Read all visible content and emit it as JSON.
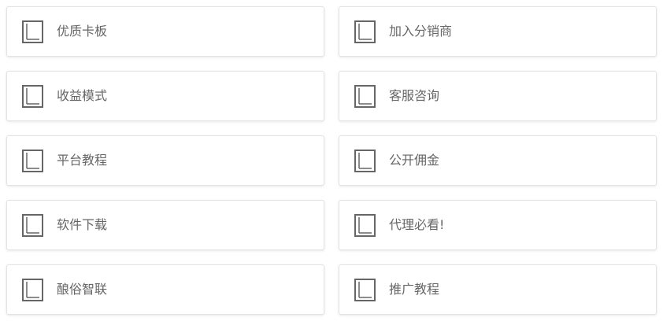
{
  "menu": {
    "items": [
      {
        "label": "优质卡板",
        "icon": "book-icon"
      },
      {
        "label": "加入分销商",
        "icon": "book-icon"
      },
      {
        "label": "收益模式",
        "icon": "book-icon"
      },
      {
        "label": "客服咨询",
        "icon": "book-icon"
      },
      {
        "label": "平台教程",
        "icon": "book-icon"
      },
      {
        "label": "公开佣金",
        "icon": "book-icon"
      },
      {
        "label": "软件下载",
        "icon": "book-icon"
      },
      {
        "label": "代理必看!",
        "icon": "book-icon"
      },
      {
        "label": "酿俗智联",
        "icon": "book-icon"
      },
      {
        "label": "推广教程",
        "icon": "book-icon"
      }
    ]
  },
  "colors": {
    "text": "#666666",
    "icon_stroke": "#666666",
    "card_border": "#e3e3e3",
    "background": "#ffffff"
  }
}
